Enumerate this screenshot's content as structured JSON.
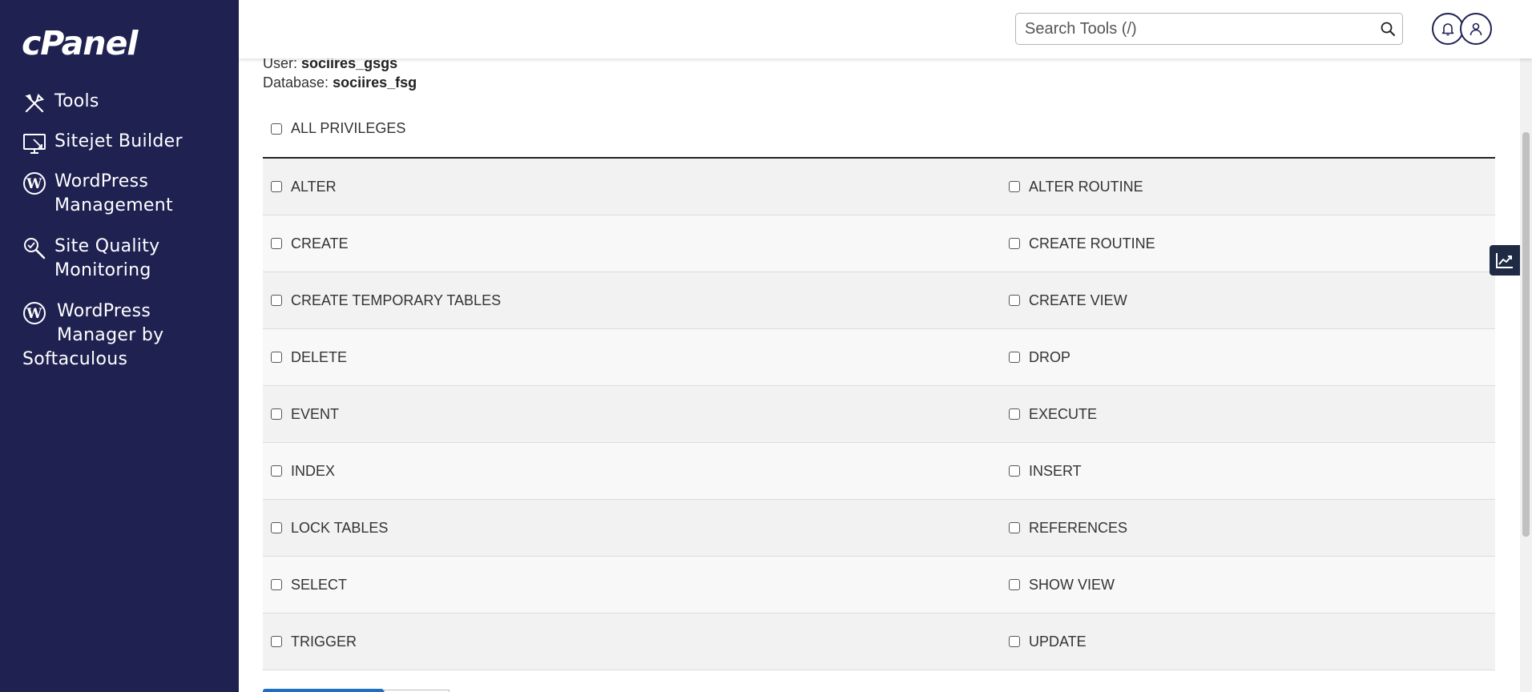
{
  "sidebar": {
    "logo": "cPanel",
    "items": [
      {
        "label": "Tools",
        "icon": "tools-icon"
      },
      {
        "label": "Sitejet Builder",
        "icon": "sitejet-icon"
      },
      {
        "label_line1": "WordPress",
        "label_line2": "Management",
        "icon": "wordpress-icon"
      },
      {
        "label_line1": "Site Quality",
        "label_line2": "Monitoring",
        "icon": "site-quality-icon"
      },
      {
        "label_line1": "WordPress",
        "label_line2": "Manager by",
        "label_line3": "Softaculous",
        "icon": "wordpress-icon"
      }
    ]
  },
  "header": {
    "search_placeholder": "Search Tools (/)",
    "icons": [
      "search-icon",
      "bell-icon",
      "user-icon"
    ]
  },
  "meta": {
    "user_label": "User:",
    "user_value": "sociires_gsgs",
    "database_label": "Database:",
    "database_value": "sociires_fsg"
  },
  "privileges": {
    "all_label": "ALL PRIVILEGES",
    "rows": [
      [
        "ALTER",
        "ALTER ROUTINE"
      ],
      [
        "CREATE",
        "CREATE ROUTINE"
      ],
      [
        "CREATE TEMPORARY TABLES",
        "CREATE VIEW"
      ],
      [
        "DELETE",
        "DROP"
      ],
      [
        "EVENT",
        "EXECUTE"
      ],
      [
        "INDEX",
        "INSERT"
      ],
      [
        "LOCK TABLES",
        "REFERENCES"
      ],
      [
        "SELECT",
        "SHOW VIEW"
      ],
      [
        "TRIGGER",
        "UPDATE"
      ]
    ]
  },
  "colors": {
    "sidebar_bg": "#1f2251",
    "accent": "#1e6fc0"
  }
}
